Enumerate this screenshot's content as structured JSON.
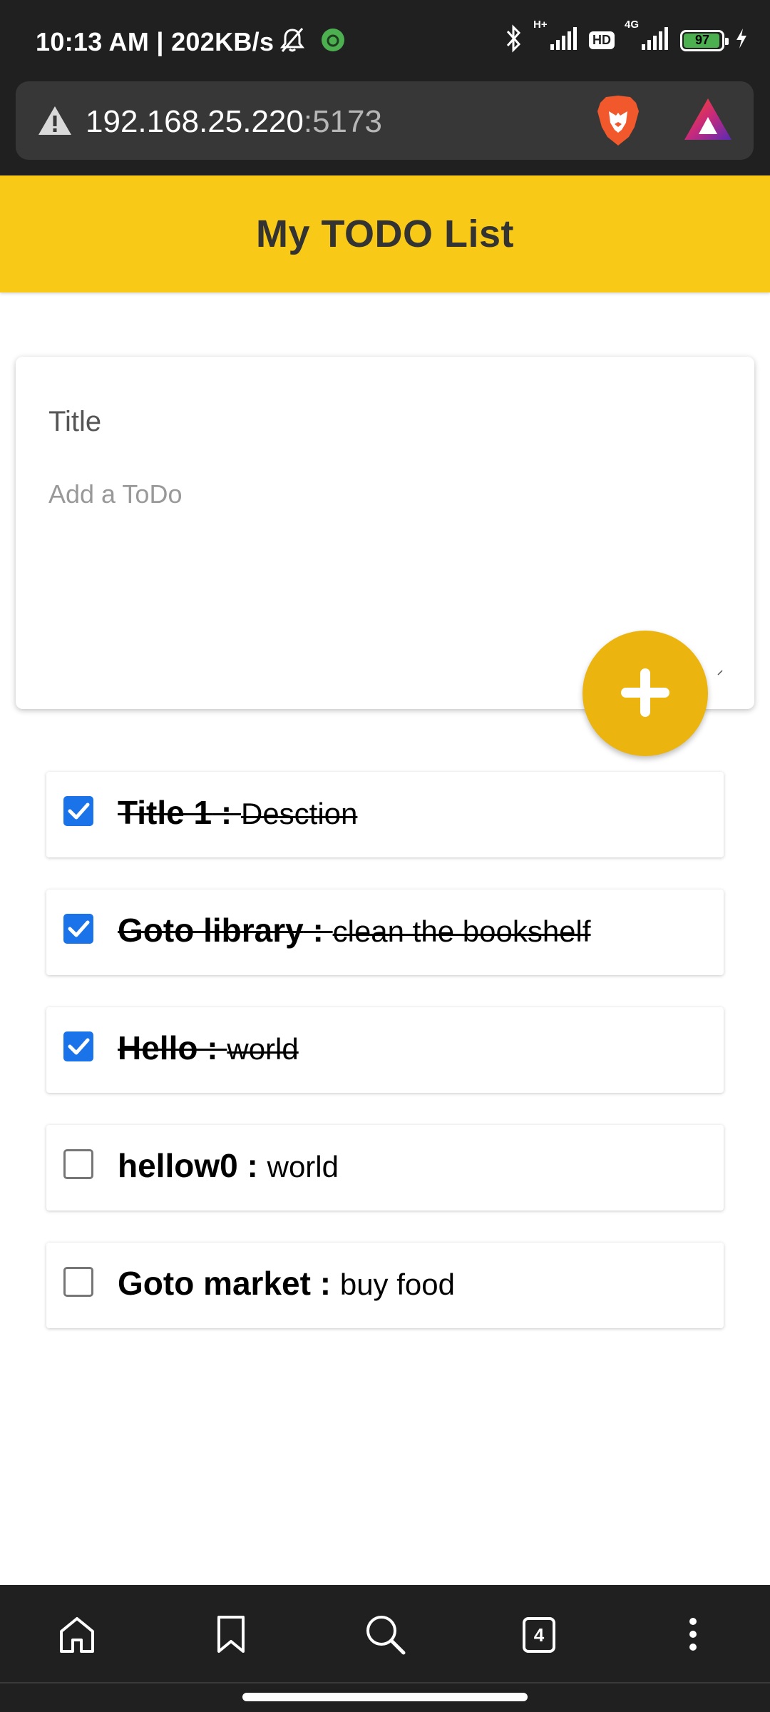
{
  "status_bar": {
    "time_speed": "10:13 AM | 202KB/s",
    "network_label": "H+",
    "hd_label": "HD",
    "network_4g": "4G",
    "battery_percent": "97",
    "battery_level": 0.97,
    "battery_color": "#4caf50"
  },
  "browser": {
    "url_host": "192.168.25.220",
    "url_port": ":5173",
    "tab_count": "4"
  },
  "app": {
    "title": "My TODO List",
    "accent_color": "#f8c916",
    "fab_color": "#ebb40f"
  },
  "form": {
    "title_placeholder": "Title",
    "title_value": "",
    "desc_placeholder": "Add a ToDo",
    "desc_value": "",
    "add_icon": "plus-icon"
  },
  "todos": [
    {
      "title": "Title 1",
      "separator": " : ",
      "description": "Desction",
      "done": true
    },
    {
      "title": "Goto library",
      "separator": " : ",
      "description": "clean the bookshelf",
      "done": true
    },
    {
      "title": "Hello",
      "separator": " : ",
      "description": "world",
      "done": true
    },
    {
      "title": "hellow0",
      "separator": " : ",
      "description": "world",
      "done": false
    },
    {
      "title": "Goto market",
      "separator": " : ",
      "description": "buy food",
      "done": false
    }
  ],
  "bottom_nav": [
    "home-icon",
    "bookmark-icon",
    "search-icon",
    "tabs-icon",
    "more-icon"
  ]
}
